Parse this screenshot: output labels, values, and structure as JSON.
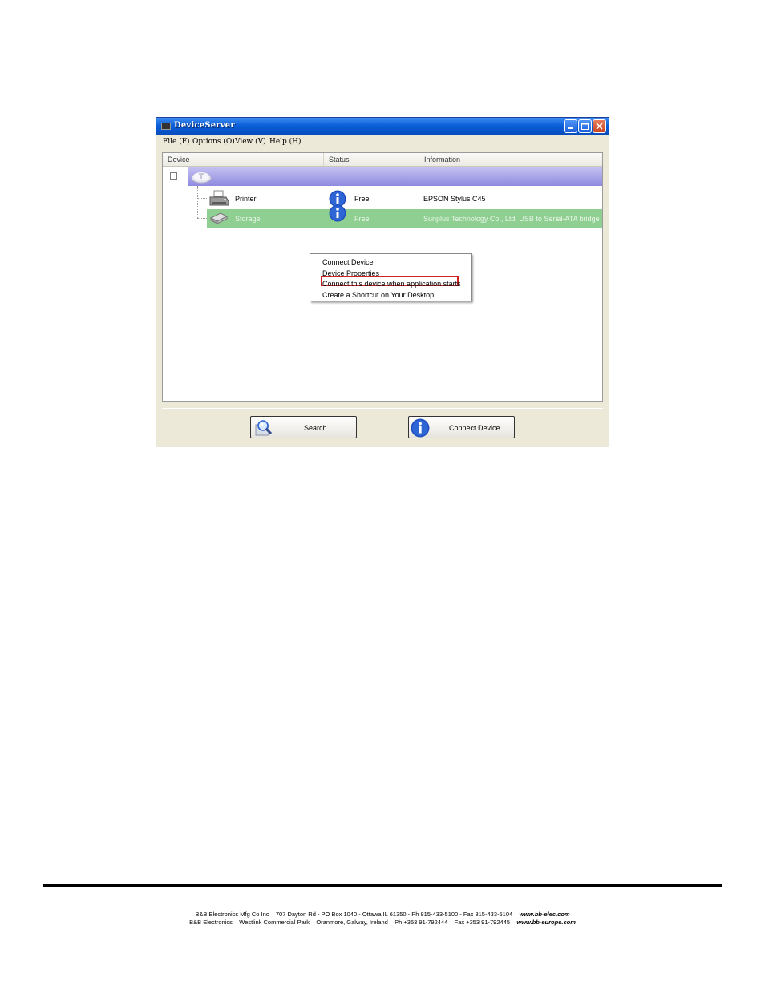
{
  "window": {
    "title": "DeviceServer",
    "menu": [
      "File (F)",
      "Options (O)",
      "View (V)",
      "Help (H)"
    ]
  },
  "list": {
    "columns": [
      "Device",
      "Status",
      "Information"
    ],
    "rows": [
      {
        "device": "Printer",
        "status": "Free",
        "information": "EPSON Stylus C45",
        "icon": "printer-icon"
      },
      {
        "device": "Storage",
        "status": "Free",
        "information": "Sunplus Technology Co., Ltd. USB to Serial-ATA bridge",
        "icon": "storage-icon"
      }
    ]
  },
  "context_menu": {
    "items": [
      "Connect Device",
      "Device Properties",
      "Connect this device when application starts",
      "Create a Shortcut on Your Desktop"
    ],
    "highlight_color": "#cc2222"
  },
  "buttons": {
    "search": "Search",
    "connect": "Connect Device"
  },
  "footer": {
    "line1_text": "B&B Electronics Mfg Co Inc – 707 Dayton Rd - PO Box 1040 - Ottawa IL 61350 - Ph 815-433-5100 - Fax 815-433-5104 – ",
    "line1_url": "www.bb-elec.com",
    "line2_text": "B&B Electronics – Westlink Commercial Park – Oranmore, Galway, Ireland – Ph +353 91-792444 – Fax +353 91-792445 – ",
    "line2_url": "www.bb-europe.com"
  },
  "colors": {
    "titlebar": "#0a5fd8",
    "group_row": "#8f8ae0",
    "selected_row": "#8fcf92"
  }
}
